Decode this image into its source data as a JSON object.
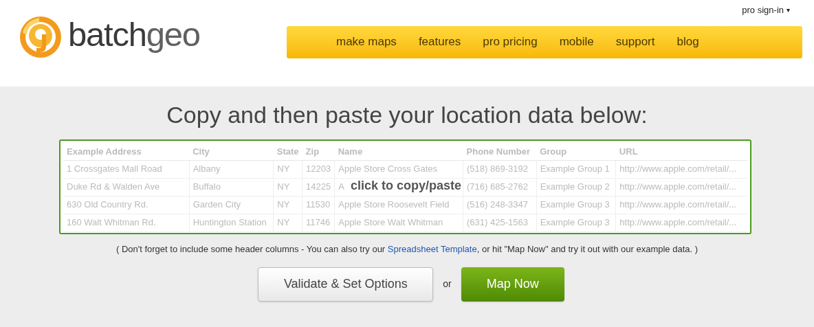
{
  "header": {
    "logo": {
      "parts": [
        "batch",
        "geo"
      ]
    },
    "account_menu": {
      "label": "pro sign-in",
      "caret": "▾"
    },
    "nav": [
      {
        "label": "make maps"
      },
      {
        "label": "features"
      },
      {
        "label": "pro pricing"
      },
      {
        "label": "mobile"
      },
      {
        "label": "support"
      },
      {
        "label": "blog"
      }
    ]
  },
  "heading": "Copy and then paste your location data below:",
  "data_table": {
    "columns": [
      "Example Address",
      "City",
      "State",
      "Zip",
      "Name",
      "Phone Number",
      "Group",
      "URL"
    ],
    "rows": [
      [
        "1 Crossgates Mall Road",
        "Albany",
        "NY",
        "12203",
        "Apple Store Cross Gates",
        "(518) 869-3192",
        "Example Group 1",
        "http://www.apple.com/retail/..."
      ],
      [
        "Duke Rd & Walden Ave",
        "Buffalo",
        "NY",
        "14225",
        "A",
        "(716) 685-2762",
        "Example Group 2",
        "http://www.apple.com/retail/..."
      ],
      [
        "630 Old Country Rd.",
        "Garden City",
        "NY",
        "11530",
        "Apple Store Roosevelt Field",
        "(516) 248-3347",
        "Example Group 3",
        "http://www.apple.com/retail/..."
      ],
      [
        "160 Walt Whitman Rd.",
        "Huntington Station",
        "NY",
        "11746",
        "Apple Store Walt Whitman",
        "(631) 425-1563",
        "Example Group 3",
        "http://www.apple.com/retail/..."
      ]
    ],
    "overlay": "click to copy/paste"
  },
  "hint": {
    "before": "( Don't forget to include some header columns - You can also try our ",
    "link": "Spreadsheet Template",
    "after": ", or hit \"Map Now\" and try it out with our example data. )"
  },
  "actions": {
    "validate": "Validate & Set Options",
    "or": "or",
    "map_now": "Map Now"
  }
}
